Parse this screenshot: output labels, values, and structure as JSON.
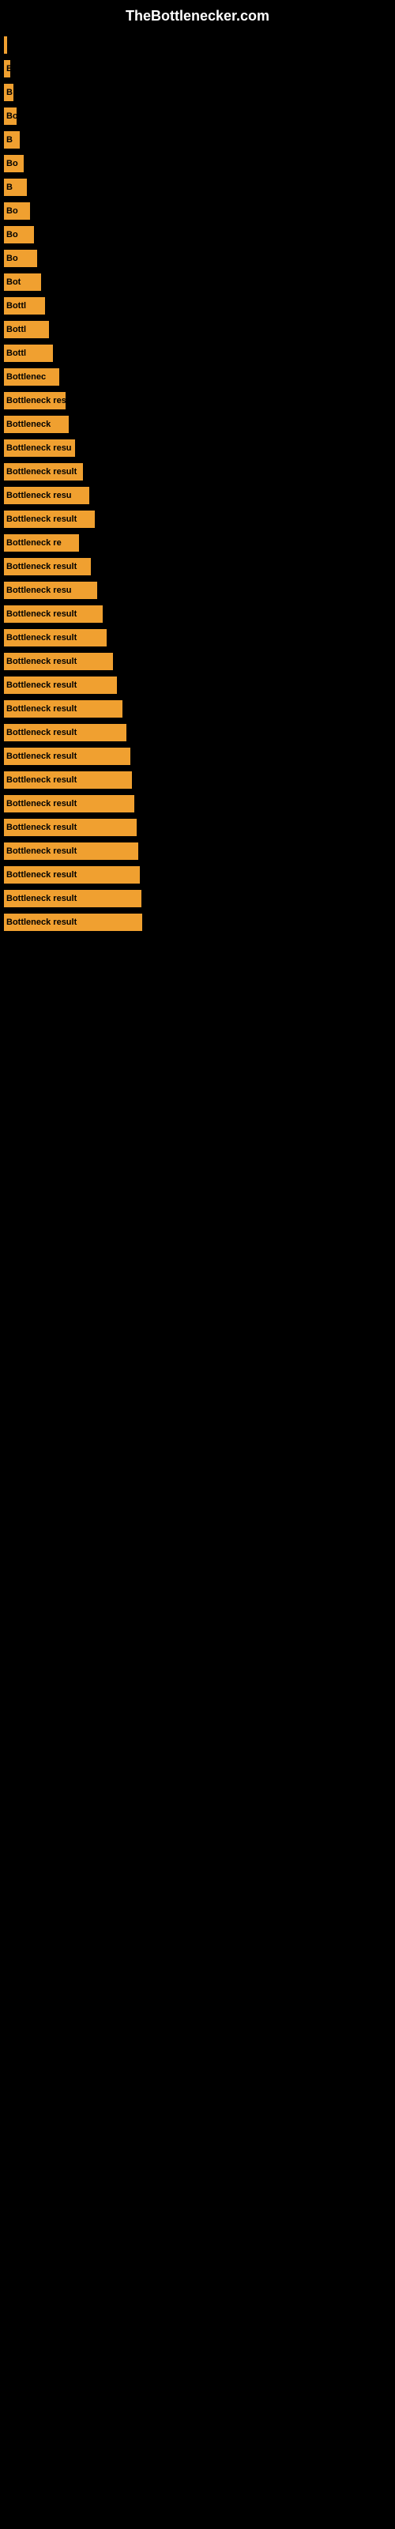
{
  "site": {
    "title": "TheBottlenecker.com"
  },
  "bars": [
    {
      "id": 1,
      "width": 4,
      "label": ""
    },
    {
      "id": 2,
      "width": 8,
      "label": "B"
    },
    {
      "id": 3,
      "width": 12,
      "label": "B"
    },
    {
      "id": 4,
      "width": 16,
      "label": "Bo"
    },
    {
      "id": 5,
      "width": 20,
      "label": "B"
    },
    {
      "id": 6,
      "width": 25,
      "label": "Bo"
    },
    {
      "id": 7,
      "width": 29,
      "label": "B"
    },
    {
      "id": 8,
      "width": 33,
      "label": "Bo"
    },
    {
      "id": 9,
      "width": 38,
      "label": "Bo"
    },
    {
      "id": 10,
      "width": 42,
      "label": "Bo"
    },
    {
      "id": 11,
      "width": 47,
      "label": "Bot"
    },
    {
      "id": 12,
      "width": 52,
      "label": "Bottl"
    },
    {
      "id": 13,
      "width": 57,
      "label": "Bottl"
    },
    {
      "id": 14,
      "width": 62,
      "label": "Bottl"
    },
    {
      "id": 15,
      "width": 70,
      "label": "Bottlenec"
    },
    {
      "id": 16,
      "width": 78,
      "label": "Bottleneck res"
    },
    {
      "id": 17,
      "width": 82,
      "label": "Bottleneck"
    },
    {
      "id": 18,
      "width": 90,
      "label": "Bottleneck resu"
    },
    {
      "id": 19,
      "width": 100,
      "label": "Bottleneck result"
    },
    {
      "id": 20,
      "width": 108,
      "label": "Bottleneck resu"
    },
    {
      "id": 21,
      "width": 115,
      "label": "Bottleneck result"
    },
    {
      "id": 22,
      "width": 95,
      "label": "Bottleneck re"
    },
    {
      "id": 23,
      "width": 110,
      "label": "Bottleneck result"
    },
    {
      "id": 24,
      "width": 118,
      "label": "Bottleneck resu"
    },
    {
      "id": 25,
      "width": 125,
      "label": "Bottleneck result"
    },
    {
      "id": 26,
      "width": 130,
      "label": "Bottleneck result"
    },
    {
      "id": 27,
      "width": 138,
      "label": "Bottleneck result"
    },
    {
      "id": 28,
      "width": 143,
      "label": "Bottleneck result"
    },
    {
      "id": 29,
      "width": 150,
      "label": "Bottleneck result"
    },
    {
      "id": 30,
      "width": 155,
      "label": "Bottleneck result"
    },
    {
      "id": 31,
      "width": 160,
      "label": "Bottleneck result"
    },
    {
      "id": 32,
      "width": 162,
      "label": "Bottleneck result"
    },
    {
      "id": 33,
      "width": 165,
      "label": "Bottleneck result"
    },
    {
      "id": 34,
      "width": 168,
      "label": "Bottleneck result"
    },
    {
      "id": 35,
      "width": 170,
      "label": "Bottleneck result"
    },
    {
      "id": 36,
      "width": 172,
      "label": "Bottleneck result"
    },
    {
      "id": 37,
      "width": 174,
      "label": "Bottleneck result"
    },
    {
      "id": 38,
      "width": 175,
      "label": "Bottleneck result"
    }
  ]
}
